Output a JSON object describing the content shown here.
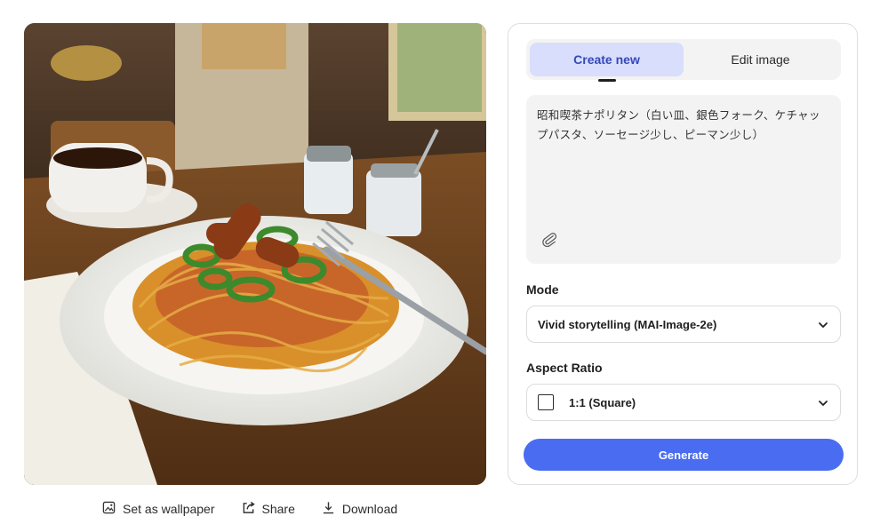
{
  "image": {
    "alt": "",
    "actions": [
      {
        "label": "Set as wallpaper",
        "icon": "wallpaper-icon"
      },
      {
        "label": "Share",
        "icon": "share-icon"
      },
      {
        "label": "Download",
        "icon": "download-icon"
      }
    ]
  },
  "panel": {
    "tabs": [
      {
        "label": "Create new",
        "active": true
      },
      {
        "label": "Edit image",
        "active": false
      }
    ],
    "prompt": {
      "value": "昭和喫茶ナポリタン（白い皿、銀色フォーク、ケチャップパスタ、ソーセージ少し、ピーマン少し）",
      "attach_icon": "paperclip-icon"
    },
    "mode": {
      "label": "Mode",
      "value": "Vivid storytelling (MAI-Image-2e)"
    },
    "aspect_ratio": {
      "label": "Aspect Ratio",
      "value": "1:1 (Square)"
    },
    "generate_label": "Generate"
  },
  "colors": {
    "accent": "#4a6cf0",
    "tab_active_bg": "#d8defb",
    "tab_active_text": "#3549b8",
    "panel_fill": "#f3f3f3"
  }
}
